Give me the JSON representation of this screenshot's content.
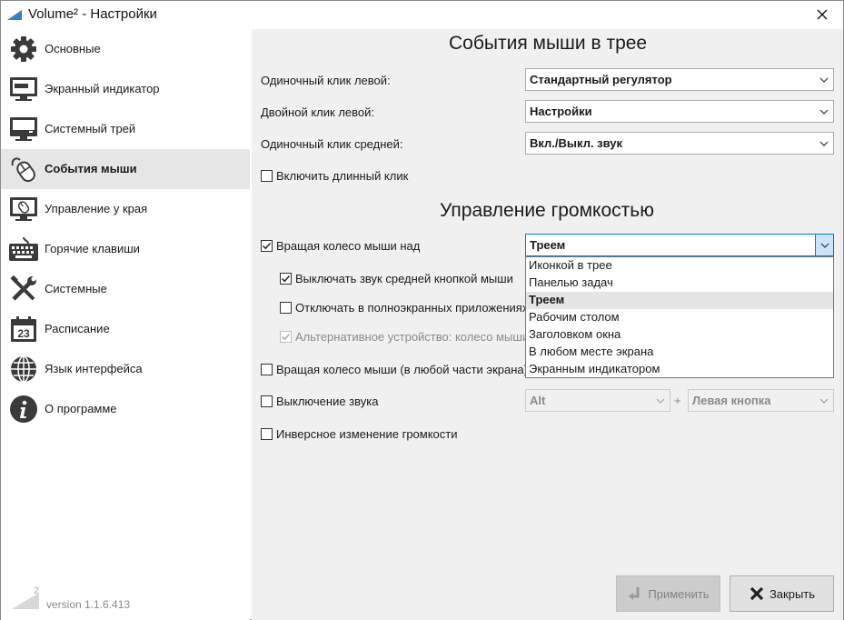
{
  "window": {
    "title": "Volume² - Настройки"
  },
  "sidebar": {
    "items": [
      {
        "label": "Основные",
        "icon": "gear-icon"
      },
      {
        "label": "Экранный индикатор",
        "icon": "monitor-icon"
      },
      {
        "label": "Системный трей",
        "icon": "tray-monitor-icon"
      },
      {
        "label": "События мыши",
        "icon": "mouse-icon",
        "active": true
      },
      {
        "label": "Управление у края",
        "icon": "screen-edge-mouse-icon"
      },
      {
        "label": "Горячие клавиши",
        "icon": "keyboard-icon"
      },
      {
        "label": "Системные",
        "icon": "tools-icon"
      },
      {
        "label": "Расписание",
        "icon": "calendar-icon",
        "day": "23"
      },
      {
        "label": "Язык интерфейса",
        "icon": "globe-icon"
      },
      {
        "label": "О программе",
        "icon": "info-icon"
      }
    ],
    "logo_sup": "2",
    "version": "version 1.1.6.413"
  },
  "tray_section": {
    "title": "События мыши в трее",
    "rows": [
      {
        "label": "Одиночный клик левой:",
        "value": "Стандартный регулятор"
      },
      {
        "label": "Двойной клик левой:",
        "value": "Настройки"
      },
      {
        "label": "Одиночный клик средней:",
        "value": "Вкл./Выкл. звук"
      }
    ],
    "long_click": {
      "label": "Включить длинный клик",
      "checked": false
    }
  },
  "volume_section": {
    "title": "Управление громкостью",
    "wheel_over": {
      "label": "Вращая колесо мыши над",
      "checked": true,
      "value": "Треем"
    },
    "mute_middle": {
      "label": "Выключать звук средней кнопкой мыши",
      "checked": true
    },
    "disable_fullscreen": {
      "label": "Отключать в полноэкранных приложениях",
      "checked": false
    },
    "alt_device": {
      "label": "Альтернативное устройство: колесо мыши",
      "checked": true,
      "disabled": true
    },
    "wheel_anywhere": {
      "label": "Вращая колесо мыши (в любой части экрана)",
      "checked": false
    },
    "mute_sound": {
      "label": "Выключение звука",
      "checked": false,
      "key": "Alt",
      "plus": "+",
      "button": "Левая кнопка"
    },
    "inverse": {
      "label": "Инверсное изменение громкости",
      "checked": false
    }
  },
  "dropdown": {
    "options": [
      "Иконкой в трее",
      "Панелью задач",
      "Треем",
      "Рабочим столом",
      "Заголовком окна",
      "В любом месте экрана",
      "Экранным индикатором"
    ],
    "selected": "Треем"
  },
  "buttons": {
    "apply": "Применить",
    "close": "Закрыть"
  },
  "colors": {
    "accent": "#0078d7",
    "active_bg": "#e6e6e6",
    "panel_bg": "#f0f0f0"
  }
}
